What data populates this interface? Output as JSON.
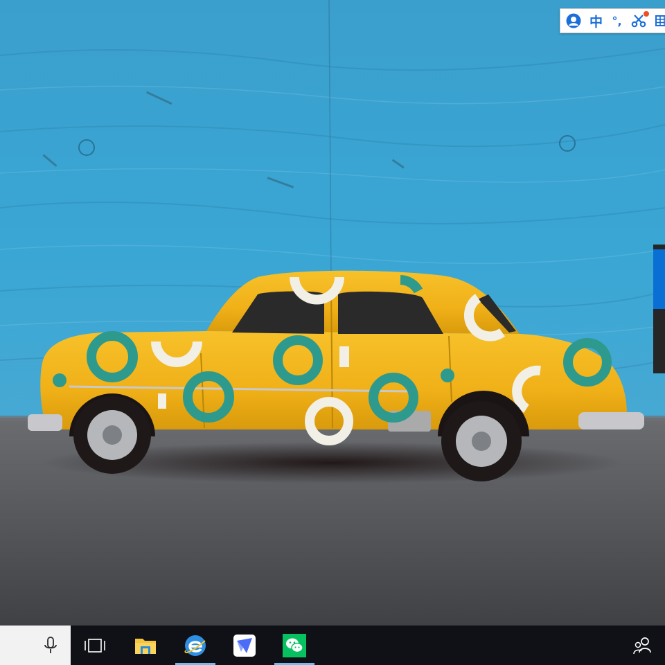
{
  "ime_toolbar": {
    "items": [
      {
        "name": "ime-logo-icon",
        "label": ""
      },
      {
        "name": "ime-language-toggle",
        "label": "中"
      },
      {
        "name": "ime-punctuation-toggle",
        "label": "°,"
      },
      {
        "name": "ime-tools-icon",
        "label": ""
      },
      {
        "name": "ime-keyboard-icon",
        "label": ""
      }
    ],
    "accent_color": "#1a6fd8",
    "badge_color": "#f04e23"
  },
  "taskbar": {
    "background": "#0f1116",
    "search_box_color": "#f2f2f2",
    "active_indicator_color": "#76b9ed",
    "buttons": [
      {
        "name": "task-view-icon",
        "active": false
      },
      {
        "name": "file-explorer-icon",
        "active": false
      },
      {
        "name": "internet-explorer-icon",
        "active": true
      },
      {
        "name": "feishu-lark-icon",
        "active": false
      },
      {
        "name": "wechat-icon",
        "active": true
      }
    ],
    "tray": [
      {
        "name": "people-icon"
      }
    ]
  },
  "wallpaper": {
    "wall_color": "#3aa3d1",
    "ground_color": "#5a5c60",
    "car_color": "#f2b51a",
    "car_pattern_colors": [
      "#2e9a8e",
      "#f1efe6"
    ]
  },
  "edge_panel": {
    "color": "#262626",
    "accent": "#0a6fd4"
  }
}
